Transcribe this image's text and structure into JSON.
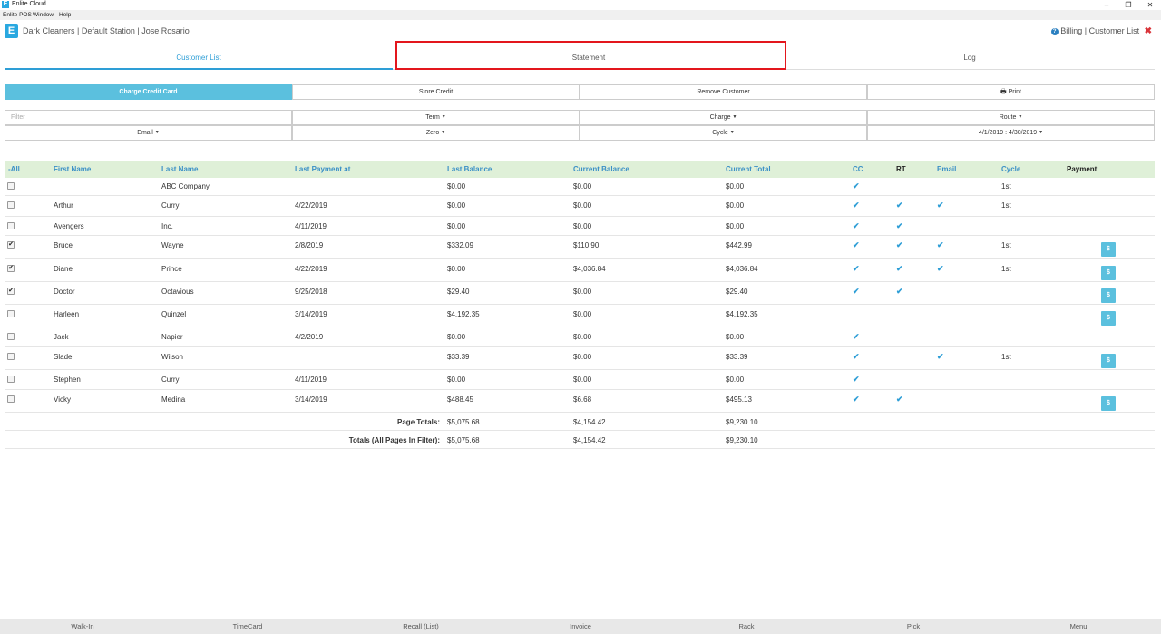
{
  "window": {
    "app_icon": "E",
    "title": "Enlite Cloud",
    "minimize": "–",
    "maximize": "❐",
    "close": "✕"
  },
  "menu": [
    "Enlite POS",
    "Window",
    "Help"
  ],
  "header": {
    "logo": "E",
    "station": "Dark Cleaners | Default Station | Jose Rosario",
    "nav": "Billing | Customer List",
    "help_glyph": "?",
    "close_glyph": "✖"
  },
  "tabs": [
    "Customer List",
    "Statement",
    "Log"
  ],
  "actions": [
    "Charge Credit Card",
    "Store Credit",
    "Remove Customer",
    "Print"
  ],
  "filters": {
    "placeholder": "Filter",
    "row1": [
      "Term",
      "Charge",
      "Route"
    ],
    "row2": [
      "Email",
      "Zero",
      "Cycle",
      "4/1/2019 : 4/30/2019"
    ]
  },
  "table": {
    "headers": [
      "-All",
      "First Name",
      "Last Name",
      "Last Payment at",
      "Last Balance",
      "Current Balance",
      "Current Total",
      "CC",
      "RT",
      "Email",
      "Cycle",
      "Payment"
    ],
    "rows": [
      {
        "checked": false,
        "first": "",
        "last": "ABC Company",
        "last_payment": "",
        "last_balance": "$0.00",
        "current_balance": "$0.00",
        "current_total": "$0.00",
        "cc": true,
        "rt": false,
        "email": false,
        "cycle": "1st",
        "pay": false
      },
      {
        "checked": false,
        "first": "Arthur",
        "last": "Curry",
        "last_payment": "4/22/2019",
        "last_balance": "$0.00",
        "current_balance": "$0.00",
        "current_total": "$0.00",
        "cc": true,
        "rt": true,
        "email": true,
        "cycle": "1st",
        "pay": false
      },
      {
        "checked": false,
        "first": "Avengers",
        "last": "Inc.",
        "last_payment": "4/11/2019",
        "last_balance": "$0.00",
        "current_balance": "$0.00",
        "current_total": "$0.00",
        "cc": true,
        "rt": true,
        "email": false,
        "cycle": "",
        "pay": false
      },
      {
        "checked": true,
        "first": "Bruce",
        "last": "Wayne",
        "last_payment": "2/8/2019",
        "last_balance": "$332.09",
        "current_balance": "$110.90",
        "current_total": "$442.99",
        "cc": true,
        "rt": true,
        "email": true,
        "cycle": "1st",
        "pay": true
      },
      {
        "checked": true,
        "first": "Diane",
        "last": "Prince",
        "last_payment": "4/22/2019",
        "last_balance": "$0.00",
        "current_balance": "$4,036.84",
        "current_total": "$4,036.84",
        "cc": true,
        "rt": true,
        "email": true,
        "cycle": "1st",
        "pay": true
      },
      {
        "checked": true,
        "first": "Doctor",
        "last": "Octavious",
        "last_payment": "9/25/2018",
        "last_balance": "$29.40",
        "current_balance": "$0.00",
        "current_total": "$29.40",
        "cc": true,
        "rt": true,
        "email": false,
        "cycle": "",
        "pay": true
      },
      {
        "checked": false,
        "first": "Harleen",
        "last": "Quinzel",
        "last_payment": "3/14/2019",
        "last_balance": "$4,192.35",
        "current_balance": "$0.00",
        "current_total": "$4,192.35",
        "cc": false,
        "rt": false,
        "email": false,
        "cycle": "",
        "pay": true
      },
      {
        "checked": false,
        "first": "Jack",
        "last": "Napier",
        "last_payment": "4/2/2019",
        "last_balance": "$0.00",
        "current_balance": "$0.00",
        "current_total": "$0.00",
        "cc": true,
        "rt": false,
        "email": false,
        "cycle": "",
        "pay": false
      },
      {
        "checked": false,
        "first": "Slade",
        "last": "Wilson",
        "last_payment": "",
        "last_balance": "$33.39",
        "current_balance": "$0.00",
        "current_total": "$33.39",
        "cc": true,
        "rt": false,
        "email": true,
        "cycle": "1st",
        "pay": true
      },
      {
        "checked": false,
        "first": "Stephen",
        "last": "Curry",
        "last_payment": "4/11/2019",
        "last_balance": "$0.00",
        "current_balance": "$0.00",
        "current_total": "$0.00",
        "cc": true,
        "rt": false,
        "email": false,
        "cycle": "",
        "pay": false
      },
      {
        "checked": false,
        "first": "Vicky",
        "last": "Medina",
        "last_payment": "3/14/2019",
        "last_balance": "$488.45",
        "current_balance": "$6.68",
        "current_total": "$495.13",
        "cc": true,
        "rt": true,
        "email": false,
        "cycle": "",
        "pay": true
      }
    ],
    "page_totals": {
      "label": "Page Totals:",
      "last_balance": "$5,075.68",
      "current_balance": "$4,154.42",
      "current_total": "$9,230.10"
    },
    "all_totals": {
      "label": "Totals (All Pages In Filter):",
      "last_balance": "$5,075.68",
      "current_balance": "$4,154.42",
      "current_total": "$9,230.10"
    },
    "check_glyph": "✔",
    "pay_glyph": "$"
  },
  "bottom": [
    "Walk-In",
    "TimeCard",
    "Recall (List)",
    "Invoice",
    "Rack",
    "Pick",
    "Menu"
  ]
}
